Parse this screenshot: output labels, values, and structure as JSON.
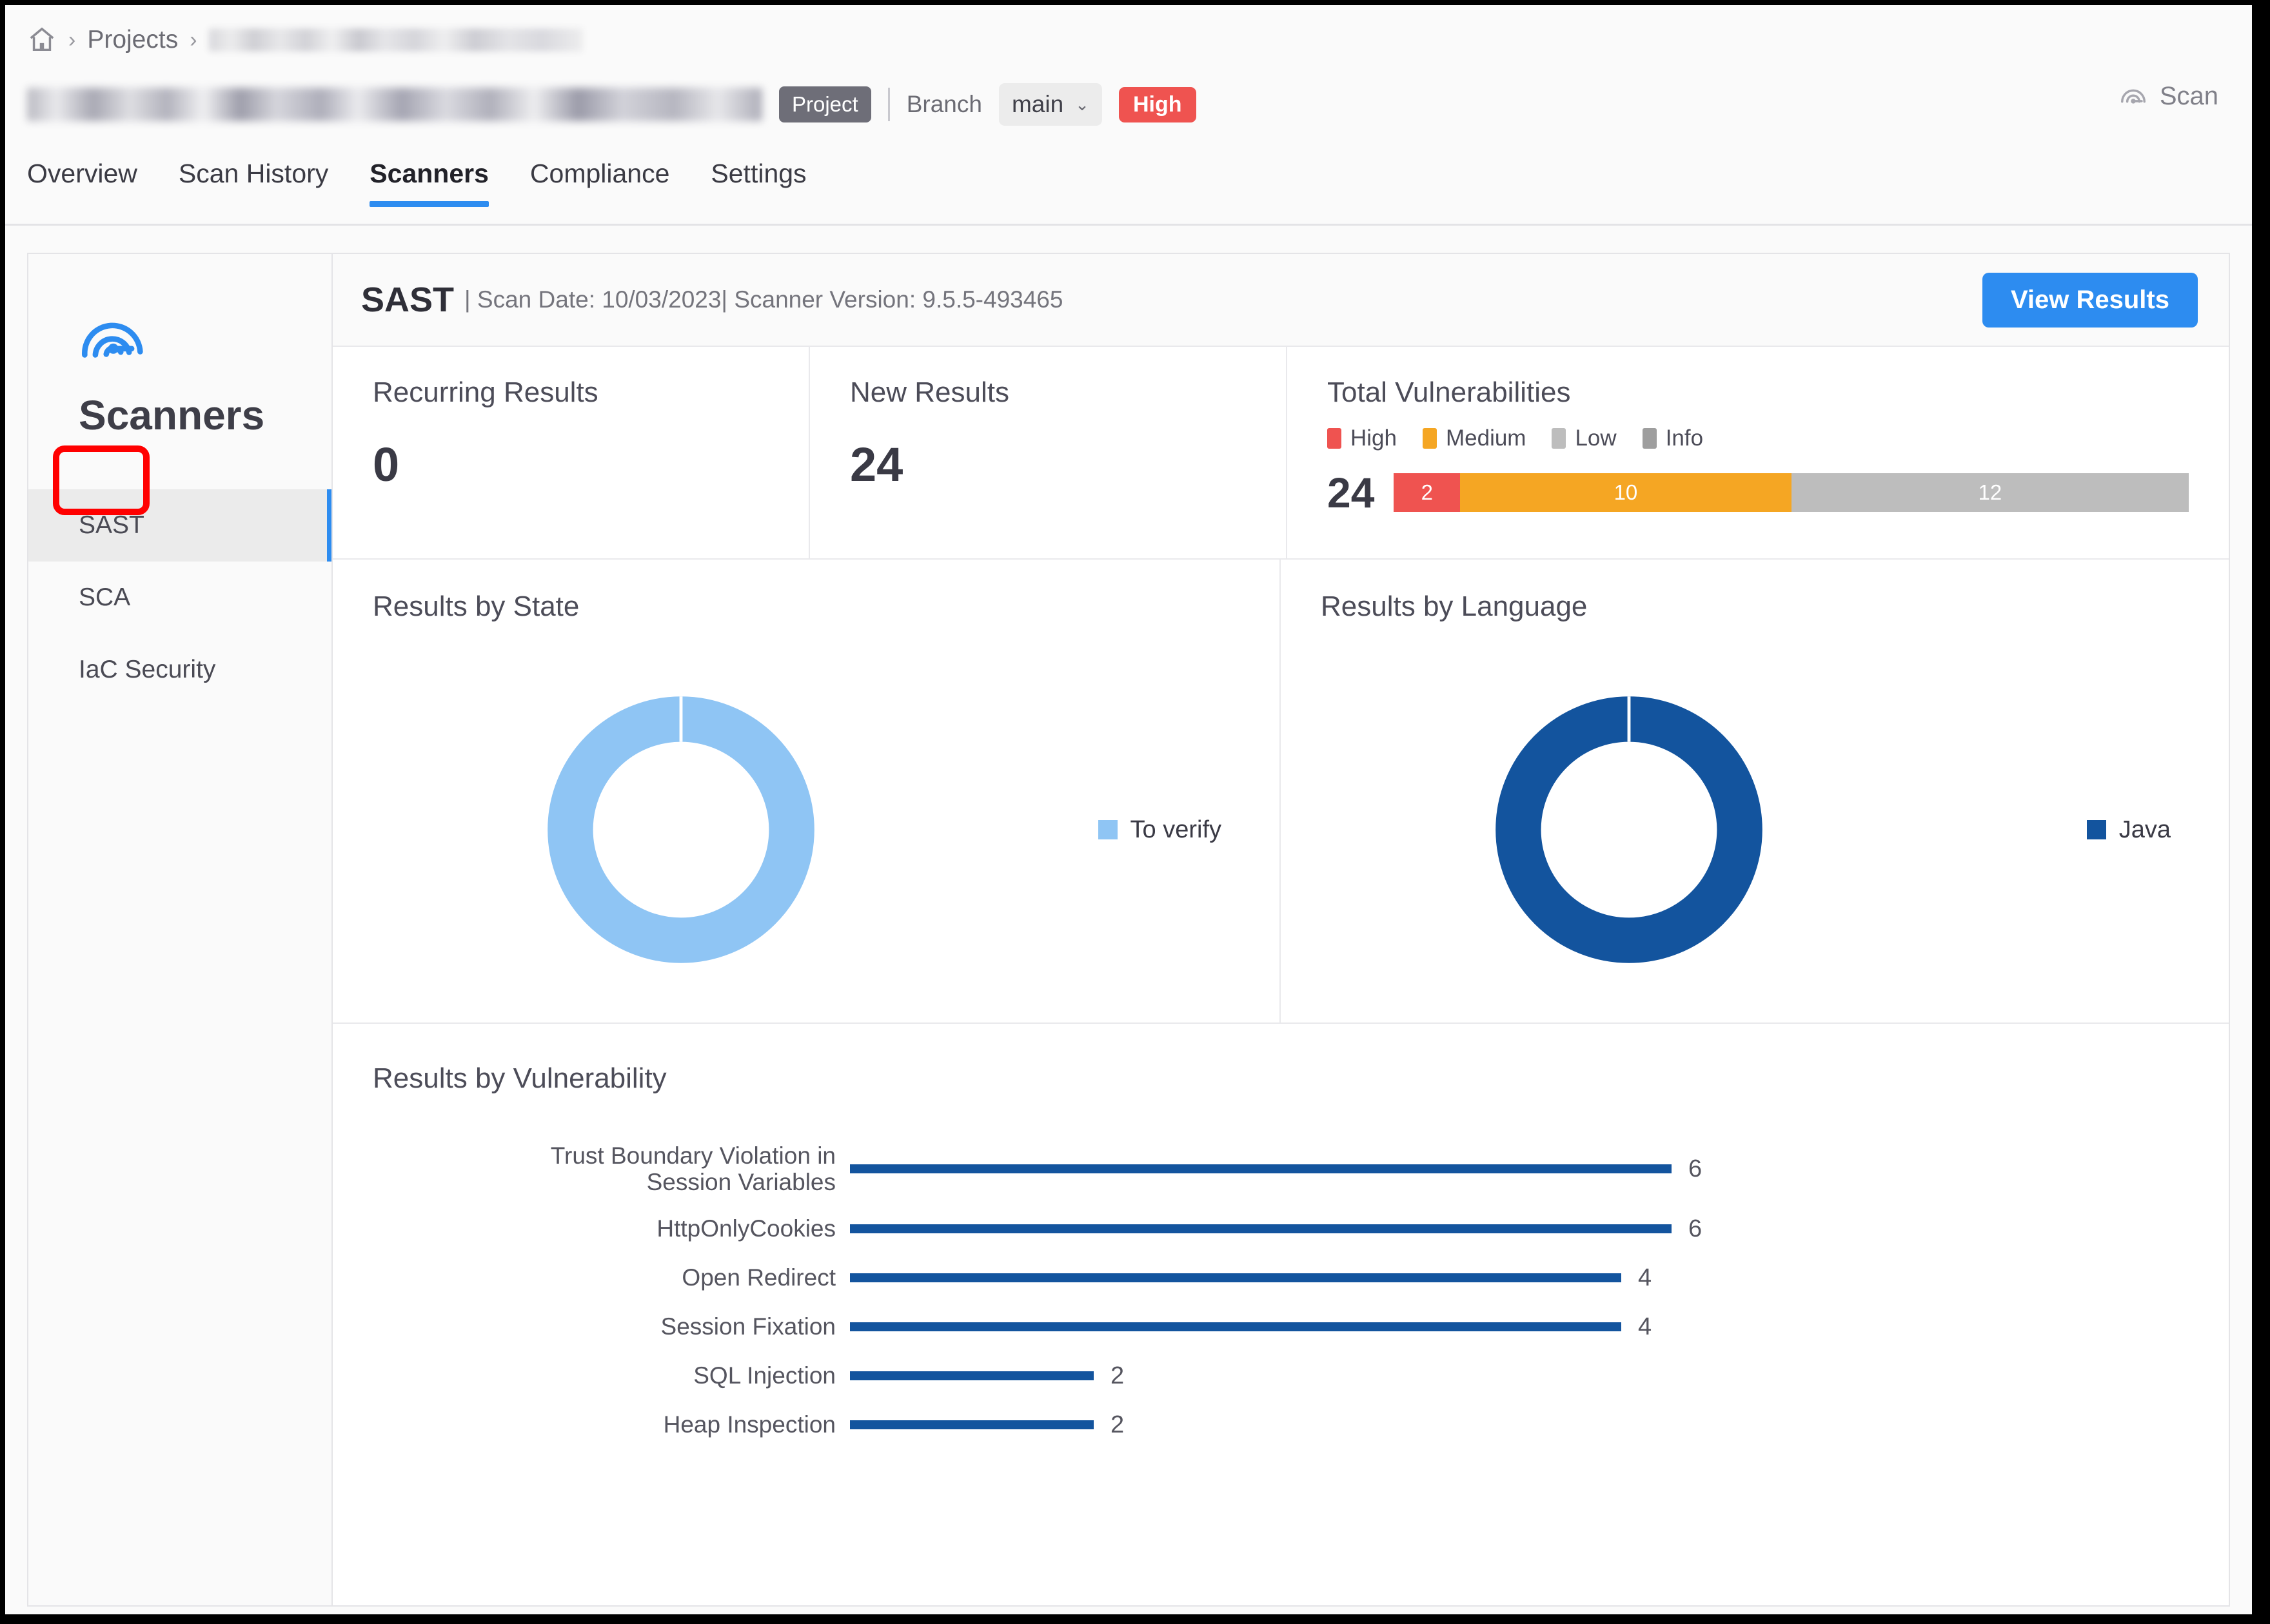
{
  "breadcrumb": {
    "home_icon": "home-icon",
    "separator": "›",
    "projects_label": "Projects",
    "redacted_project": ""
  },
  "header": {
    "redacted_title": "",
    "project_tag": "Project",
    "branch_label": "Branch",
    "branch_value": "main",
    "branch_caret": "⌄",
    "risk_badge": "High",
    "scan_button": "Scan",
    "scan_icon": "scan-spiral-icon"
  },
  "tabs": [
    {
      "label": "Overview",
      "active": false
    },
    {
      "label": "Scan History",
      "active": false
    },
    {
      "label": "Scanners",
      "active": true
    },
    {
      "label": "Compliance",
      "active": false
    },
    {
      "label": "Settings",
      "active": false
    }
  ],
  "sidebar": {
    "logo_icon": "checkmarx-spiral-logo-icon",
    "title": "Scanners",
    "items": [
      {
        "label": "SAST",
        "active": true
      },
      {
        "label": "SCA",
        "active": false
      },
      {
        "label": "IaC Security",
        "active": false
      }
    ]
  },
  "scanner": {
    "name": "SAST",
    "meta": "| Scan Date: 10/03/2023| Scanner Version: 9.5.5-493465",
    "scan_date": "10/03/2023",
    "scanner_version": "9.5.5-493465",
    "view_results_label": "View Results"
  },
  "kpis": {
    "recurring": {
      "label": "Recurring Results",
      "value": "0"
    },
    "new": {
      "label": "New Results",
      "value": "24"
    },
    "total": {
      "label": "Total Vulnerabilities",
      "value": "24"
    }
  },
  "panels": {
    "results_by_state": "Results by State",
    "results_by_language": "Results by Language",
    "results_by_vulnerability": "Results by Vulnerability"
  },
  "colors": {
    "accent_blue": "#2d8cf0",
    "high": "#ef5350",
    "medium": "#f5a623",
    "low": "#bdbdbd",
    "info": "#9e9e9e",
    "state_to_verify": "#8fc5f4",
    "language_java": "#13549e",
    "annotation_red": "#ff0000"
  },
  "chart_data": [
    {
      "type": "bar",
      "title": "Total Vulnerabilities",
      "orientation": "horizontal-stacked",
      "total": 24,
      "categories": [
        "High",
        "Medium",
        "Low",
        "Info"
      ],
      "values": [
        2,
        10,
        12,
        0
      ],
      "colors": [
        "#ef5350",
        "#f5a623",
        "#bdbdbd",
        "#9e9e9e"
      ],
      "segment_labels": [
        "2",
        "10",
        "12"
      ],
      "legend": [
        "High",
        "Medium",
        "Low",
        "Info"
      ],
      "legend_position": "top",
      "grid": false
    },
    {
      "type": "pie",
      "title": "Results by State",
      "donut": true,
      "labels": [
        "To verify"
      ],
      "values": [
        24
      ],
      "percentages": [
        100
      ],
      "colors": [
        "#8fc5f4"
      ],
      "legend": [
        "To verify"
      ],
      "legend_position": "right"
    },
    {
      "type": "pie",
      "title": "Results by Language",
      "donut": true,
      "labels": [
        "Java"
      ],
      "values": [
        24
      ],
      "percentages": [
        100
      ],
      "colors": [
        "#13549e"
      ],
      "legend": [
        "Java"
      ],
      "legend_position": "right"
    },
    {
      "type": "bar",
      "title": "Results by Vulnerability",
      "orientation": "horizontal",
      "categories": [
        "Trust Boundary Violation in Session Variables",
        "HttpOnlyCookies",
        "Open Redirect",
        "Session Fixation",
        "SQL Injection",
        "Heap Inspection"
      ],
      "values": [
        6,
        6,
        4,
        4,
        2,
        2
      ],
      "value_labels": [
        "6",
        "6",
        "4",
        "4",
        "2",
        "2"
      ],
      "color": "#13549e",
      "xlabel": "",
      "ylabel": "",
      "xlim": [
        0,
        6
      ],
      "grid": false,
      "legend": []
    }
  ],
  "vulnerability_rows": [
    {
      "label_line1": "Trust Boundary Violation in",
      "label_line2": "Session Variables",
      "value": "6",
      "width_pct": 100
    },
    {
      "label_line1": "HttpOnlyCookies",
      "label_line2": "",
      "value": "6",
      "width_pct": 100
    },
    {
      "label_line1": "Open Redirect",
      "label_line2": "",
      "value": "4",
      "width_pct": 94
    },
    {
      "label_line1": "Session Fixation",
      "label_line2": "",
      "value": "4",
      "width_pct": 94
    },
    {
      "label_line1": "SQL Injection",
      "label_line2": "",
      "value": "2",
      "width_pct": 30
    },
    {
      "label_line1": "Heap Inspection",
      "label_line2": "",
      "value": "2",
      "width_pct": 30
    }
  ]
}
